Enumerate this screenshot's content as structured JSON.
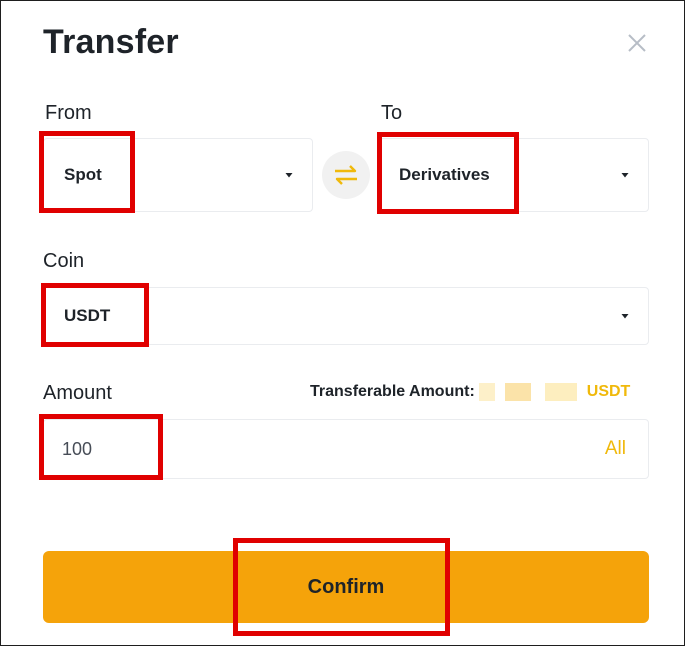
{
  "dialog": {
    "title": "Transfer",
    "close_icon": "close-icon"
  },
  "from": {
    "label": "From",
    "selected": "Spot"
  },
  "swap": {
    "icon": "swap-arrows-icon",
    "color": "#f0b90b"
  },
  "to": {
    "label": "To",
    "selected": "Derivatives"
  },
  "coin": {
    "label": "Coin",
    "selected": "USDT"
  },
  "amount": {
    "label": "Amount",
    "value": "100",
    "all_label": "All",
    "transferable_label": "Transferable Amount:",
    "transferable_unit": "USDT"
  },
  "confirm": {
    "label": "Confirm"
  },
  "colors": {
    "accent": "#f0b90b",
    "confirm_bg": "#f5a30a",
    "highlight": "#e00000"
  }
}
